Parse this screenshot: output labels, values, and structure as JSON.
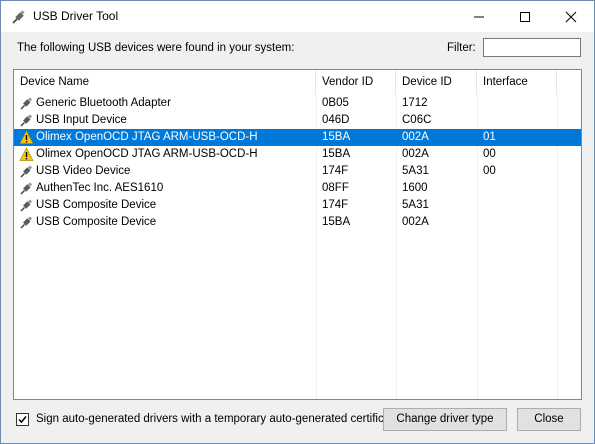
{
  "window": {
    "title": "USB Driver Tool",
    "icon": "usb-plug-icon",
    "controls": [
      "minimize-icon",
      "maximize-icon",
      "close-icon"
    ]
  },
  "intro_text": "The following USB devices were found in your system:",
  "filter": {
    "label": "Filter:",
    "value": ""
  },
  "table": {
    "columns": [
      "Device Name",
      "Vendor ID",
      "Device ID",
      "Interface"
    ],
    "rows": [
      {
        "name": "Generic Bluetooth Adapter",
        "vendor": "0B05",
        "device": "1712",
        "iface": "",
        "icon": "usb-plug-icon"
      },
      {
        "name": "USB Input Device",
        "vendor": "046D",
        "device": "C06C",
        "iface": "",
        "icon": "usb-plug-icon"
      },
      {
        "name": "Olimex OpenOCD JTAG ARM-USB-OCD-H",
        "vendor": "15BA",
        "device": "002A",
        "iface": "01",
        "icon": "warning-icon",
        "selected": true
      },
      {
        "name": "Olimex OpenOCD JTAG ARM-USB-OCD-H",
        "vendor": "15BA",
        "device": "002A",
        "iface": "00",
        "icon": "warning-icon"
      },
      {
        "name": "USB Video Device",
        "vendor": "174F",
        "device": "5A31",
        "iface": "00",
        "icon": "usb-plug-icon"
      },
      {
        "name": "AuthenTec Inc. AES1610",
        "vendor": "08FF",
        "device": "1600",
        "iface": "",
        "icon": "usb-plug-icon"
      },
      {
        "name": "USB Composite Device",
        "vendor": "174F",
        "device": "5A31",
        "iface": "",
        "icon": "usb-plug-icon"
      },
      {
        "name": "USB Composite Device",
        "vendor": "15BA",
        "device": "002A",
        "iface": "",
        "icon": "usb-plug-icon"
      }
    ]
  },
  "options": {
    "sign_drivers_label": "Sign auto-generated drivers with a temporary auto-generated certificate",
    "sign_drivers_checked": true
  },
  "buttons": {
    "change_driver": "Change driver type",
    "close": "Close"
  },
  "colors": {
    "selection": "#0078d7",
    "warning": "#f5c518"
  }
}
